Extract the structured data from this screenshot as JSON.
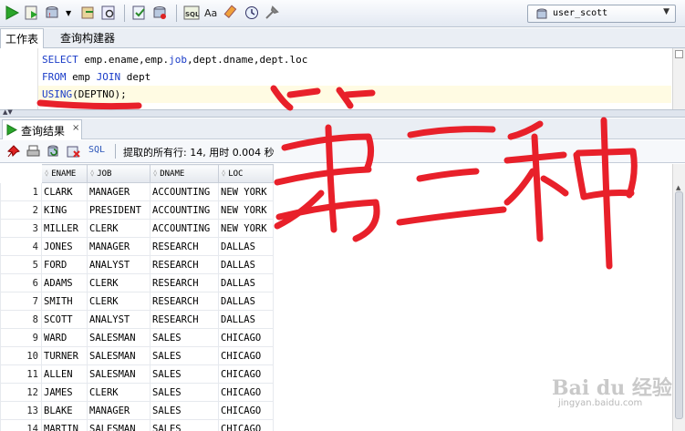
{
  "toolbar": {
    "connection": "user_scott",
    "buttons": [
      "run-statement",
      "run-script",
      "commit",
      "rollback",
      "explain-plan",
      "autotrace",
      "clear",
      "sql-tuning",
      "to-upper-lower",
      "clear-eraser",
      "sql-history",
      "tools"
    ]
  },
  "tabs": {
    "worksheet": "工作表",
    "query_builder": "查询构建器"
  },
  "editor": {
    "line1": {
      "kw": "SELECT",
      "rest": " emp.ename,emp.",
      "kw2": "job",
      "rest2": ",dept.dname,dept.loc"
    },
    "line2": {
      "kw": "FROM",
      "rest": " emp ",
      "kw2": "JOIN",
      "rest2": " dept"
    },
    "line3": {
      "kw": "USING",
      "rest": "(DEPTNO);"
    }
  },
  "results": {
    "tab_label": "查询结果",
    "tab_close": "×",
    "sql_link": "SQL",
    "status": "提取的所有行: 14, 用时 0.004 秒",
    "columns": [
      "ENAME",
      "JOB",
      "DNAME",
      "LOC"
    ],
    "rows": [
      [
        "1",
        "CLARK",
        "MANAGER",
        "ACCOUNTING",
        "NEW YORK"
      ],
      [
        "2",
        "KING",
        "PRESIDENT",
        "ACCOUNTING",
        "NEW YORK"
      ],
      [
        "3",
        "MILLER",
        "CLERK",
        "ACCOUNTING",
        "NEW YORK"
      ],
      [
        "4",
        "JONES",
        "MANAGER",
        "RESEARCH",
        "DALLAS"
      ],
      [
        "5",
        "FORD",
        "ANALYST",
        "RESEARCH",
        "DALLAS"
      ],
      [
        "6",
        "ADAMS",
        "CLERK",
        "RESEARCH",
        "DALLAS"
      ],
      [
        "7",
        "SMITH",
        "CLERK",
        "RESEARCH",
        "DALLAS"
      ],
      [
        "8",
        "SCOTT",
        "ANALYST",
        "RESEARCH",
        "DALLAS"
      ],
      [
        "9",
        "WARD",
        "SALESMAN",
        "SALES",
        "CHICAGO"
      ],
      [
        "10",
        "TURNER",
        "SALESMAN",
        "SALES",
        "CHICAGO"
      ],
      [
        "11",
        "ALLEN",
        "SALESMAN",
        "SALES",
        "CHICAGO"
      ],
      [
        "12",
        "JAMES",
        "CLERK",
        "SALES",
        "CHICAGO"
      ],
      [
        "13",
        "BLAKE",
        "MANAGER",
        "SALES",
        "CHICAGO"
      ],
      [
        "14",
        "MARTIN",
        "SALESMAN",
        "SALES",
        "CHICAGO"
      ]
    ]
  },
  "annotation": {
    "handwritten_text": "第三种",
    "color": "#e8202a"
  },
  "watermark": {
    "brand": "Bai du 经验",
    "url": "jingyan.baidu.com"
  },
  "colors": {
    "keyword": "#1a3cc8",
    "highlight_line": "#fffbe3",
    "run_green": "#2aa52a"
  }
}
